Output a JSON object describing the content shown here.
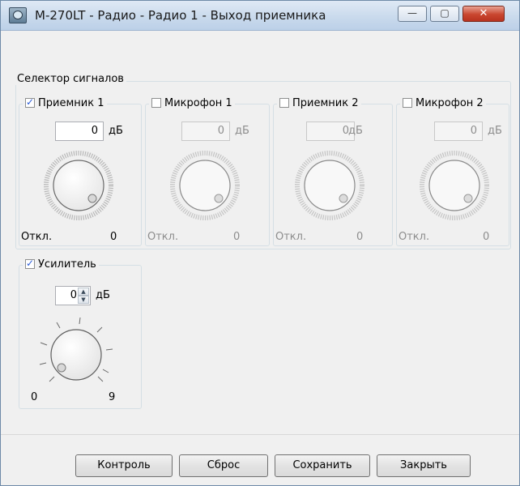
{
  "window": {
    "title": "M-270LT - Радио - Радио 1 - Выход приемника"
  },
  "titlebar_buttons": {
    "minimize": "—",
    "maximize": "▢",
    "close": "✕"
  },
  "selector": {
    "label": "Селектор сигналов",
    "channels": [
      {
        "label": "Приемник 1",
        "checked": true,
        "value": "0",
        "unit": "дБ",
        "min_label": "Откл.",
        "max_label": "0"
      },
      {
        "label": "Микрофон 1",
        "checked": false,
        "value": "0",
        "unit": "дБ",
        "min_label": "Откл.",
        "max_label": "0"
      },
      {
        "label": "Приемник 2",
        "checked": false,
        "value": "0",
        "unit": "дБ",
        "min_label": "Откл.",
        "max_label": "0"
      },
      {
        "label": "Микрофон 2",
        "checked": false,
        "value": "0",
        "unit": "дБ",
        "min_label": "Откл.",
        "max_label": "0"
      }
    ]
  },
  "amplifier": {
    "label": "Усилитель",
    "checked": true,
    "value": "0",
    "unit": "дБ",
    "min_label": "0",
    "max_label": "9"
  },
  "buttons": {
    "control": "Контроль",
    "reset": "Сброс",
    "save": "Сохранить",
    "close": "Закрыть"
  }
}
